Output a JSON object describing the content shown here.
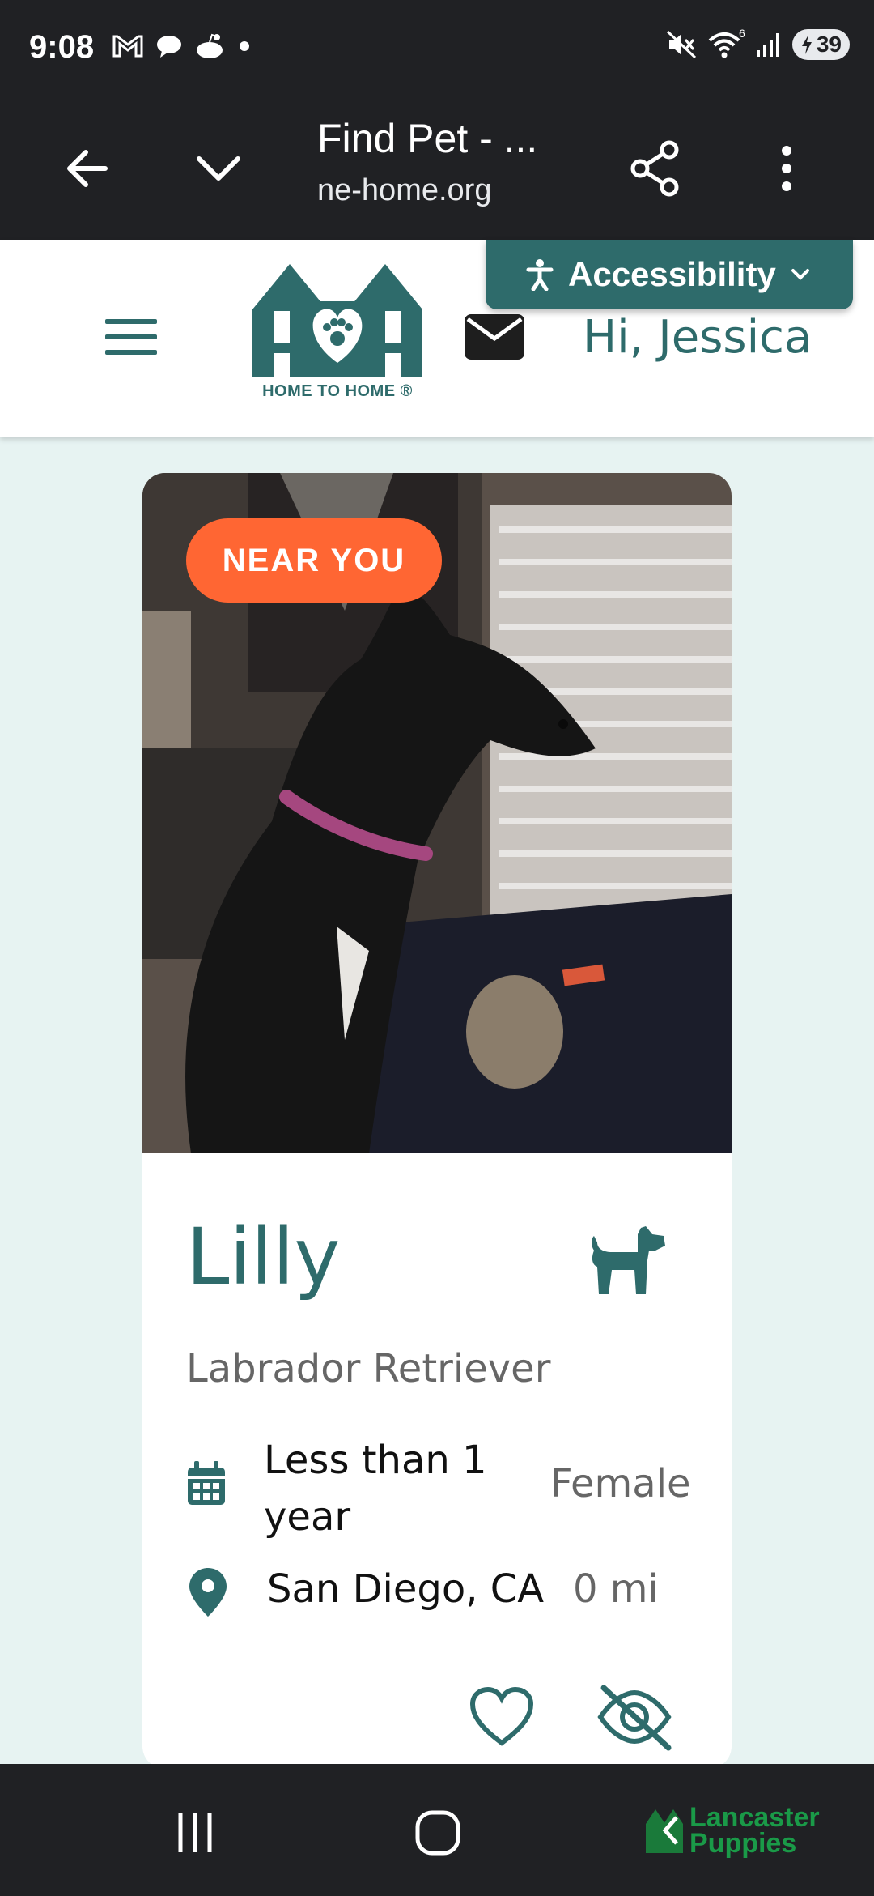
{
  "status_bar": {
    "time": "9:08",
    "battery": "39"
  },
  "browser": {
    "page_title": "Find Pet - ...",
    "url": "ne-home.org"
  },
  "header": {
    "logo_text": "HOME TO HOME ®",
    "greeting": "Hi, Jessica",
    "accessibility_label": "Accessibility"
  },
  "pet": {
    "badge": "NEAR YOU",
    "name": "Lilly",
    "type_icon": "dog-icon",
    "breed": "Labrador Retriever",
    "age": "Less than 1 year",
    "sex": "Female",
    "location": "San Diego, CA",
    "distance": "0 mi"
  },
  "watermark": {
    "line1": "Lancaster",
    "line2": "Puppies"
  },
  "colors": {
    "brand": "#2e6b6b",
    "badge": "#ff6633",
    "background": "#e7f3f2"
  }
}
